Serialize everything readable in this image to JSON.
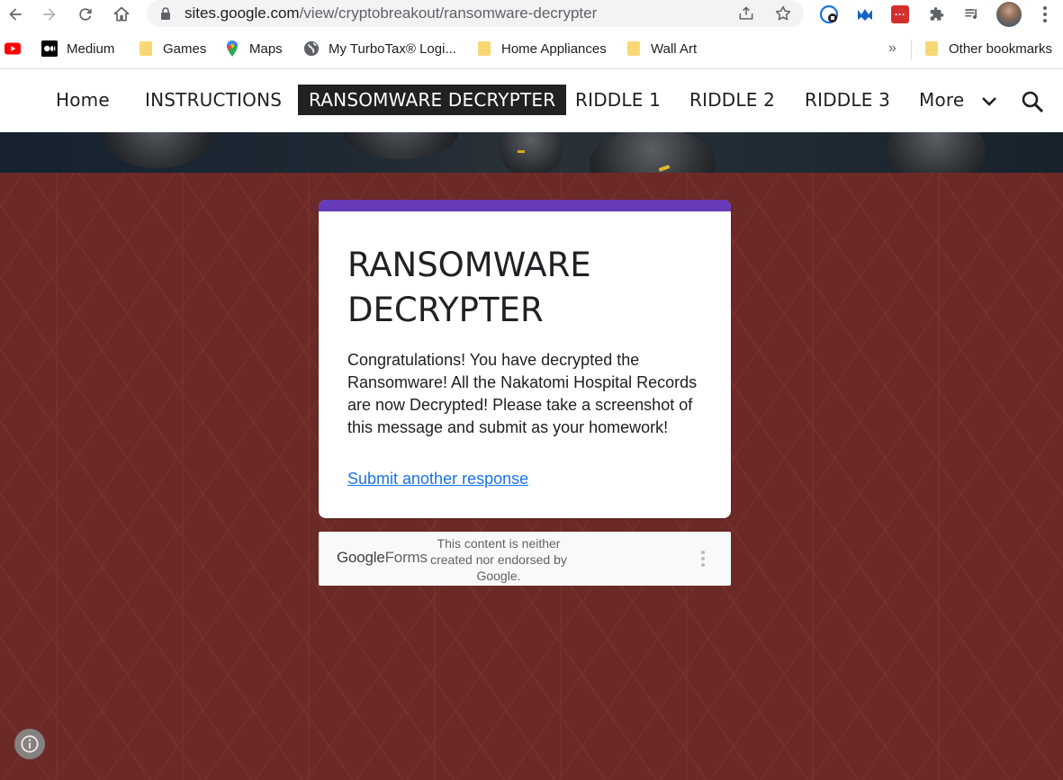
{
  "browser": {
    "url_host": "sites.google.com",
    "url_path": "/view/cryptobreakout/ransomware-decrypter",
    "icons": [
      "back-icon",
      "forward-icon",
      "reload-icon",
      "home-icon",
      "lock-icon",
      "share-icon",
      "star-icon",
      "extensions-icon",
      "media-icon",
      "profile-avatar",
      "menu-icon"
    ]
  },
  "bookmarks": {
    "items": [
      {
        "label": "",
        "icon": "youtube-icon"
      },
      {
        "label": "Medium",
        "icon": "medium-icon"
      },
      {
        "label": "Games",
        "icon": "folder-icon"
      },
      {
        "label": "Maps",
        "icon": "maps-icon"
      },
      {
        "label": "My TurboTax® Logi...",
        "icon": "globe-icon"
      },
      {
        "label": "Home Appliances",
        "icon": "folder-icon"
      },
      {
        "label": "Wall Art",
        "icon": "folder-icon"
      }
    ],
    "overflow_label": "»",
    "other_label": "Other bookmarks"
  },
  "site_nav": {
    "items": [
      {
        "label": "Home",
        "active": false
      },
      {
        "label": "INSTRUCTIONS",
        "active": false
      },
      {
        "label": "RANSOMWARE DECRYPTER",
        "active": true
      },
      {
        "label": "RIDDLE 1",
        "active": false
      },
      {
        "label": "RIDDLE 2",
        "active": false
      },
      {
        "label": "RIDDLE 3",
        "active": false
      },
      {
        "label": "More",
        "active": false
      }
    ]
  },
  "form": {
    "title": "RANSOMWARE DECRYPTER",
    "message": "Congratulations!  You have decrypted the Ransomware!  All the Nakatomi Hospital Records are now Decrypted!  Please take a screenshot of this message and submit as your homework!",
    "link_label": "Submit another response",
    "accent_color": "#673ab7"
  },
  "footer": {
    "logo_google": "Google",
    "logo_forms": "Forms",
    "disclaimer": "This content is neither created nor endorsed by Google."
  },
  "colors": {
    "page_background": "#6b2a27",
    "nav_active_bg": "#212121",
    "link": "#1a73e8"
  }
}
